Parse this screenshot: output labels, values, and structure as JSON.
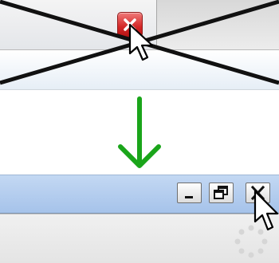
{
  "top_panel": {
    "tab_close_icon": "close-icon",
    "tab_close_color": "#d32727",
    "cross_out_color": "#111111"
  },
  "arrow": {
    "icon": "arrow-down-icon",
    "color": "#1aa51a"
  },
  "titlebar": {
    "buttons": [
      "minimize-icon",
      "restore-icon",
      "close-icon"
    ],
    "color": "#a6c3ea"
  },
  "status": {
    "icon": "loading-spinner-icon"
  },
  "cursors": [
    "mouse-pointer-icon",
    "mouse-pointer-icon"
  ]
}
